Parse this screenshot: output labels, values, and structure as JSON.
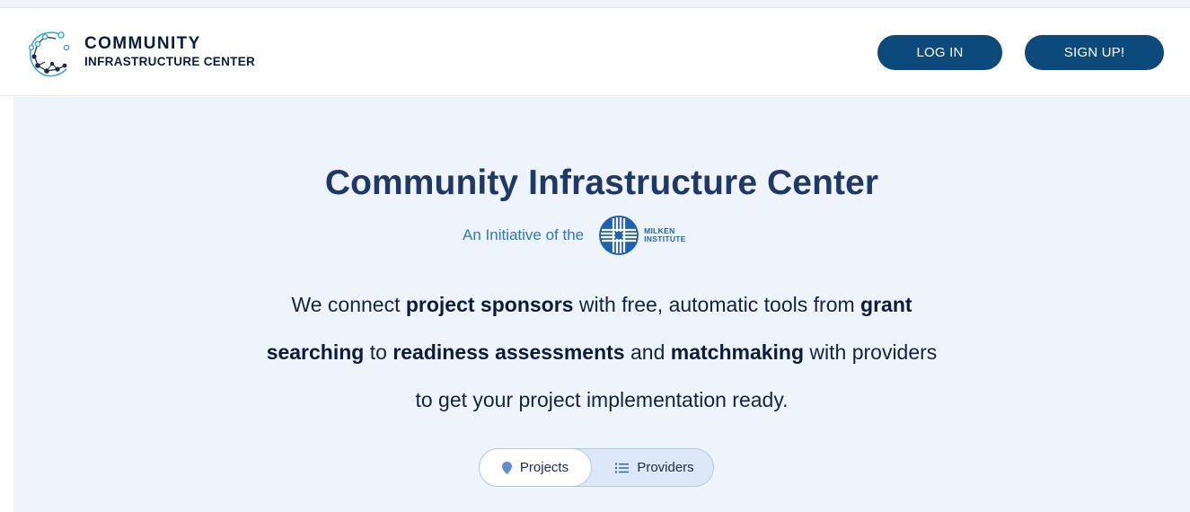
{
  "header": {
    "logo_line1": "COMMUNITY",
    "logo_line2": "INFRASTRUCTURE CENTER",
    "login_label": "LOG IN",
    "signup_label": "SIGN UP!"
  },
  "hero": {
    "title": "Community Infrastructure Center",
    "initiative_text": "An Initiative of the",
    "partner_logo_line1": "MILKEN",
    "partner_logo_line2": "INSTITUTE",
    "tagline": {
      "l1a": "We connect ",
      "l1b": "project sponsors",
      "l1c": " with free, automatic tools from ",
      "l1d": "grant",
      "l2a": "searching",
      "l2b": " to ",
      "l2c": "readiness assessments",
      "l2d": " and ",
      "l2e": "matchmaking",
      "l2f": " with providers",
      "l3": "to get your project implementation ready."
    }
  },
  "toggle": {
    "options": [
      {
        "label": "Projects",
        "icon": "map-pin-icon",
        "selected": true
      },
      {
        "label": "Providers",
        "icon": "list-icon",
        "selected": false
      }
    ]
  },
  "colors": {
    "brand_dark": "#0d4a7c",
    "title": "#1f3865",
    "accent_link": "#2c77c2",
    "hero_bg": "#eef4fb"
  }
}
